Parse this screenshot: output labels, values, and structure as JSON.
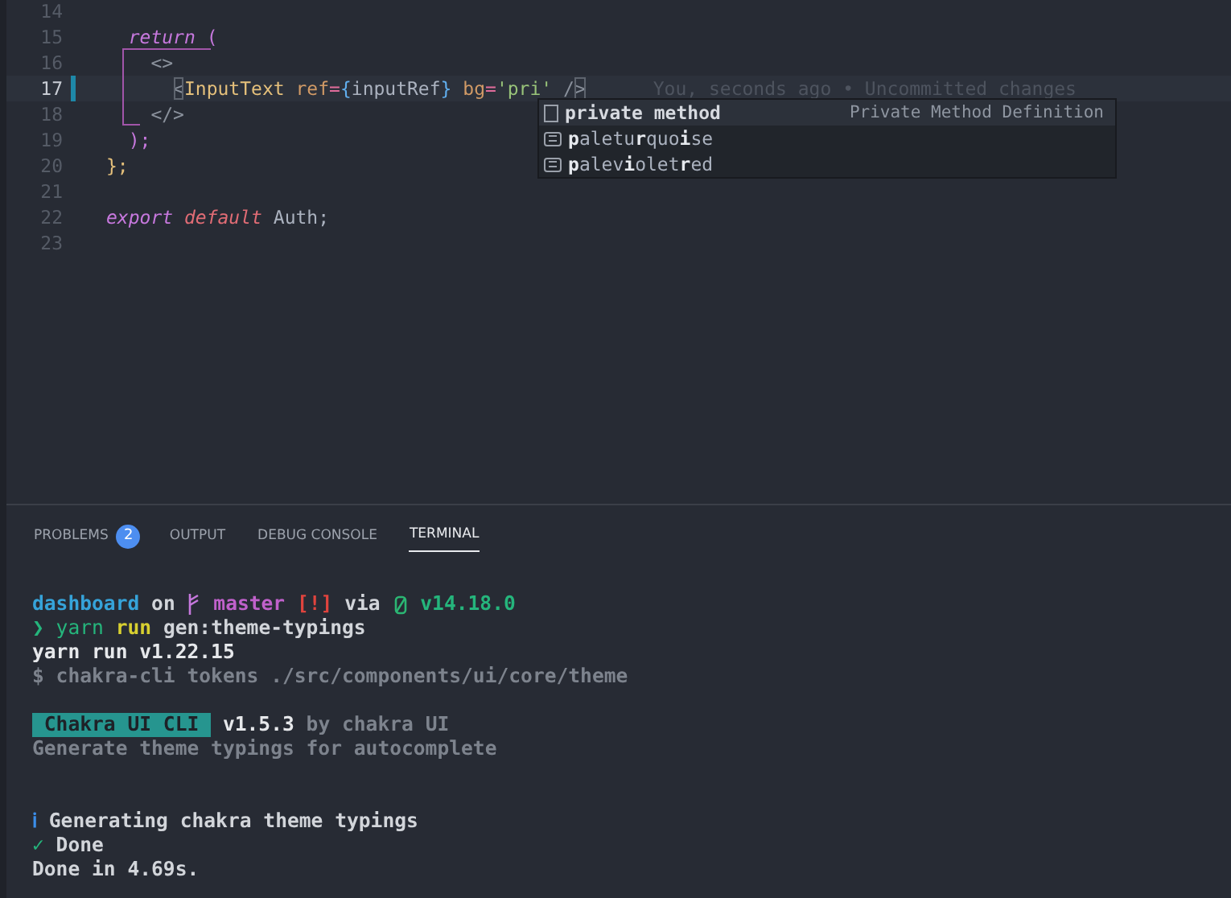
{
  "editor": {
    "lines": [
      {
        "number": "14",
        "current": false,
        "modified": false
      },
      {
        "number": "15",
        "current": false,
        "modified": false,
        "tokens": [
          {
            "text": "  return",
            "kind": "keyword"
          },
          {
            "text": " (",
            "kind": "paren"
          }
        ]
      },
      {
        "number": "16",
        "current": false,
        "modified": false,
        "tokens": [
          {
            "text": "    <>",
            "kind": "punct"
          }
        ]
      },
      {
        "number": "17",
        "current": true,
        "modified": true,
        "tokens": [
          {
            "text": "      <",
            "kind": "match"
          },
          {
            "text": "InputText",
            "kind": "tag"
          },
          {
            "text": " ref",
            "kind": "attr"
          },
          {
            "text": "=",
            "kind": "op"
          },
          {
            "text": "{",
            "kind": "brace"
          },
          {
            "text": "inputRef",
            "kind": "plain"
          },
          {
            "text": "} ",
            "kind": "brace"
          },
          {
            "text": "bg",
            "kind": "attr"
          },
          {
            "text": "=",
            "kind": "op"
          },
          {
            "text": "'pri'",
            "kind": "string"
          },
          {
            "text": " /",
            "kind": "punct"
          },
          {
            "text": ">",
            "kind": "match"
          }
        ],
        "annotation": "You, seconds ago • Uncommitted changes"
      },
      {
        "number": "18",
        "current": false,
        "modified": false,
        "tokens": [
          {
            "text": "    </>",
            "kind": "punct"
          }
        ]
      },
      {
        "number": "19",
        "current": false,
        "modified": false,
        "tokens": [
          {
            "text": "  );",
            "kind": "paren"
          }
        ]
      },
      {
        "number": "20",
        "current": false,
        "modified": false,
        "tokens": [
          {
            "text": "};",
            "kind": "brace2"
          }
        ]
      },
      {
        "number": "21",
        "current": false,
        "modified": false
      },
      {
        "number": "22",
        "current": false,
        "modified": false,
        "tokens": [
          {
            "text": "export",
            "kind": "keyword"
          },
          {
            "text": " default",
            "kind": "keyword2"
          },
          {
            "text": " Auth;",
            "kind": "plain"
          }
        ]
      },
      {
        "number": "23",
        "current": false,
        "modified": false
      }
    ],
    "suggestions": [
      {
        "kind": "snippet",
        "label": "private method",
        "selected": true,
        "detail": "Private Method Definition"
      },
      {
        "kind": "value",
        "label": "**p**aletu**r**quo**i**se",
        "selected": false
      },
      {
        "kind": "value",
        "label": "**p**alev**i**olet**r**ed",
        "selected": false
      }
    ]
  },
  "panel": {
    "tabs": [
      {
        "label": "PROBLEMS",
        "selected": false,
        "badge": "2"
      },
      {
        "label": "OUTPUT",
        "selected": false
      },
      {
        "label": "DEBUG CONSOLE",
        "selected": false
      },
      {
        "label": "TERMINAL",
        "selected": true
      }
    ],
    "terminal": [
      [
        [
          {
            "text": "dashboard",
            "kind": "dir"
          },
          {
            "text": " on ",
            "kind": "plain"
          },
          {
            "kind": "branch-icon"
          },
          {
            "text": " master",
            "kind": "branch"
          },
          {
            "text": " [!]",
            "kind": "status"
          },
          {
            "text": " via ",
            "kind": "plain"
          },
          {
            "kind": "node-icon"
          },
          {
            "text": " v14.18.0",
            "kind": "version"
          }
        ],
        [
          {
            "text": "❯",
            "kind": "prompt"
          },
          {
            "text": " yarn",
            "kind": "cmd"
          },
          {
            "text": " run",
            "kind": "arg"
          },
          {
            "text": " gen:theme-typings",
            "kind": "plain"
          }
        ],
        [
          {
            "text": "yarn run v1.22.15",
            "kind": "bold"
          }
        ],
        [
          {
            "text": "$ chakra-cli tokens ./src/components/ui/core/theme",
            "kind": "dim"
          }
        ]
      ],
      [
        [
          {
            "text": " Chakra UI CLI ",
            "kind": "label"
          },
          {
            "text": " v1.5.3",
            "kind": "bold"
          },
          {
            "text": " by chakra UI",
            "kind": "dim"
          }
        ],
        [
          {
            "text": "Generate theme typings for autocomplete",
            "kind": "dim"
          }
        ]
      ],
      [
        [
          {
            "text": "ℹ",
            "kind": "info"
          },
          {
            "text": " Generating chakra theme typings",
            "kind": "plain"
          }
        ],
        [
          {
            "text": "✓",
            "kind": "success"
          },
          {
            "text": " Done",
            "kind": "plain"
          }
        ],
        [
          {
            "text": "Done in 4.69s.",
            "kind": "plain"
          }
        ]
      ]
    ]
  }
}
